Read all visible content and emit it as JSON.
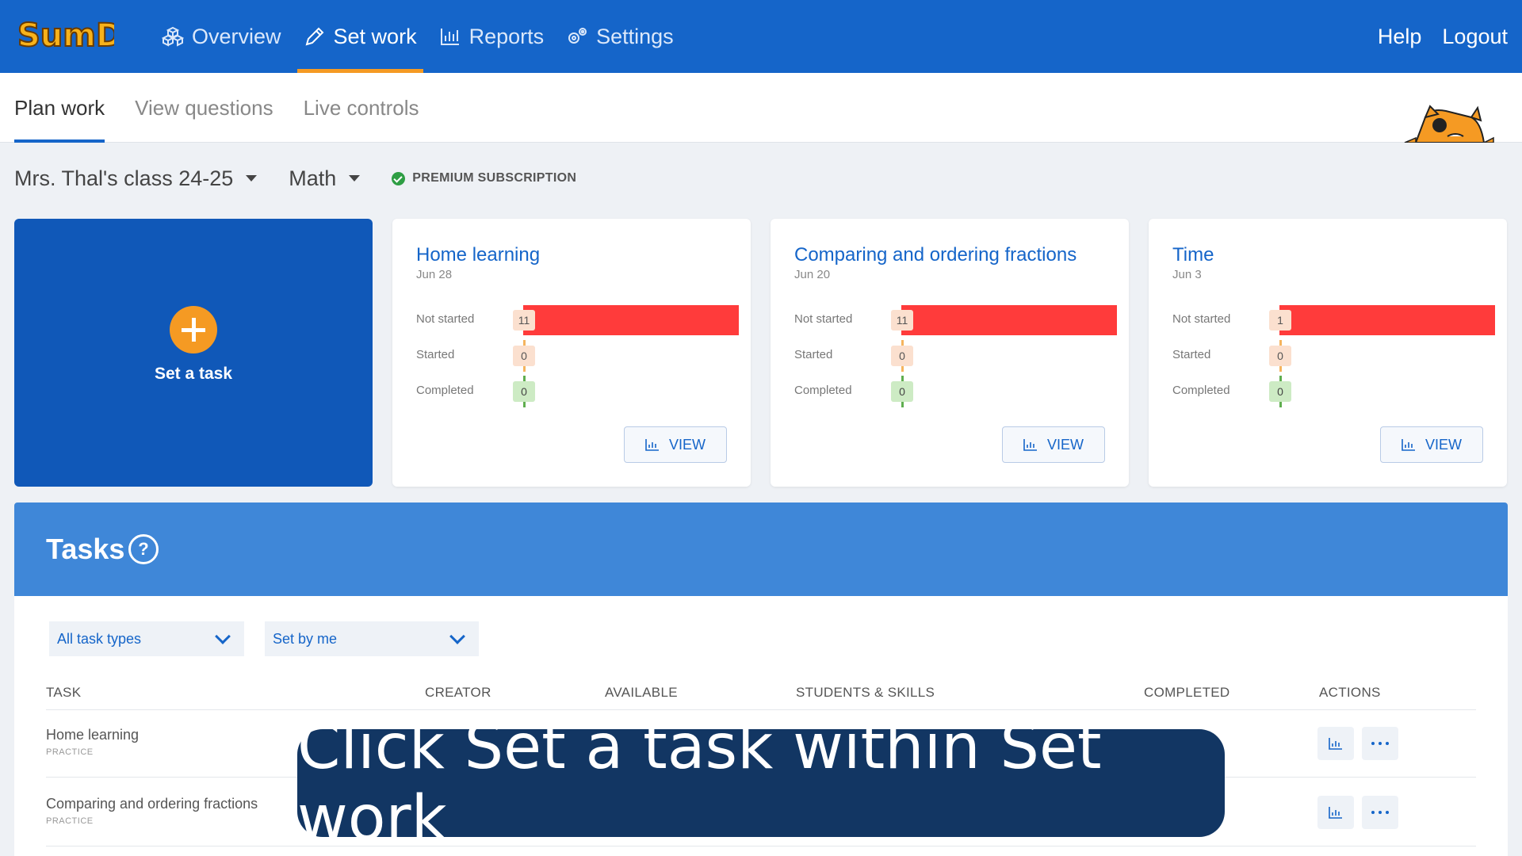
{
  "app": {
    "logo_text": "SumDog"
  },
  "nav": {
    "items": [
      {
        "label": "Overview",
        "icon": "cubes-icon"
      },
      {
        "label": "Set work",
        "icon": "pencil-icon",
        "active": true
      },
      {
        "label": "Reports",
        "icon": "bar-chart-icon"
      },
      {
        "label": "Settings",
        "icon": "gears-icon"
      }
    ],
    "help": "Help",
    "logout": "Logout"
  },
  "subtabs": [
    {
      "label": "Plan work",
      "active": true
    },
    {
      "label": "View questions"
    },
    {
      "label": "Live controls"
    }
  ],
  "selectors": {
    "class_name": "Mrs. Thal's class 24-25",
    "subject": "Math",
    "premium": "PREMIUM SUBSCRIPTION"
  },
  "new_task": {
    "label": "Set a task"
  },
  "status_labels": {
    "not_started": "Not started",
    "started": "Started",
    "completed": "Completed"
  },
  "cards": [
    {
      "title": "Home learning",
      "date": "Jun 28",
      "not_started": "11",
      "started": "0",
      "completed": "0",
      "not_started_fraction": 1.0,
      "view": "VIEW"
    },
    {
      "title": "Comparing and ordering fractions",
      "date": "Jun 20",
      "not_started": "11",
      "started": "0",
      "completed": "0",
      "not_started_fraction": 1.0,
      "view": "VIEW"
    },
    {
      "title": "Time",
      "date": "Jun 3",
      "not_started": "1",
      "started": "0",
      "completed": "0",
      "not_started_fraction": 1.0,
      "view": "VIEW"
    }
  ],
  "tasks": {
    "title": "Tasks",
    "help": "?",
    "filter_type": "All task types",
    "filter_setter": "Set by me",
    "columns": [
      "TASK",
      "CREATOR",
      "AVAILABLE",
      "STUDENTS & SKILLS",
      "COMPLETED",
      "ACTIONS"
    ],
    "rows": [
      {
        "name": "Home learning",
        "type": "PRACTICE"
      },
      {
        "name": "Comparing and ordering fractions",
        "type": "PRACTICE"
      }
    ]
  },
  "caption": "Click Set a task within Set work",
  "colors": {
    "brand": "#1565c9",
    "accent": "#f59a23",
    "not_started": "#ff3b3b",
    "completed": "#cdebc4",
    "tasks_header": "#3f87d8",
    "caption_bg": "#123663"
  }
}
